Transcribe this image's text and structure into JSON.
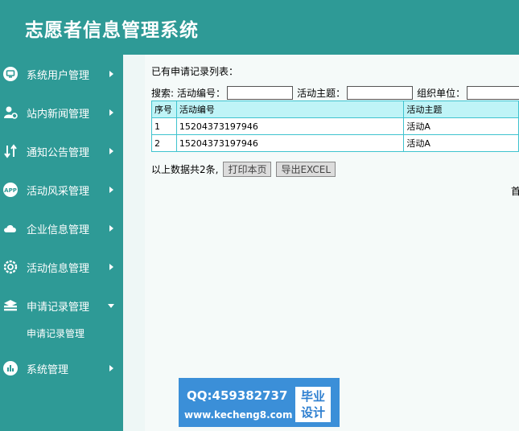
{
  "app": {
    "title": "志愿者信息管理系统"
  },
  "sidebar": {
    "items": [
      {
        "label": "系统用户管理",
        "icon": "monitor-icon"
      },
      {
        "label": "站内新闻管理",
        "icon": "user-settings-icon"
      },
      {
        "label": "通知公告管理",
        "icon": "transfer-icon"
      },
      {
        "label": "活动风采管理",
        "icon": "app-icon"
      },
      {
        "label": "企业信息管理",
        "icon": "cloud-icon"
      },
      {
        "label": "活动信息管理",
        "icon": "gear-icon"
      },
      {
        "label": "申请记录管理",
        "icon": "stack-icon",
        "expanded": true
      },
      {
        "label": "系统管理",
        "icon": "bar-chart-icon"
      }
    ],
    "sub_items": [
      {
        "label": "申请记录管理"
      }
    ]
  },
  "main": {
    "list_title": "已有申请记录列表：",
    "search": {
      "label": "搜索:",
      "field1_label": "活动编号：",
      "field2_label": "活动主题：",
      "field3_label": "组织单位：",
      "field1_value": "",
      "field2_value": "",
      "field3_value": ""
    },
    "table": {
      "headers": [
        "序号",
        "活动编号",
        "活动主题"
      ],
      "rows": [
        [
          "1",
          "15204373197946",
          "活动A"
        ],
        [
          "2",
          "15204373197946",
          "活动A"
        ]
      ]
    },
    "summary": "以上数据共2条,",
    "print_button": "打印本页",
    "export_button": "导出EXCEL",
    "pager_text": "首"
  },
  "banner": {
    "qq": "QQ:459382737",
    "site": "www.kecheng8.com",
    "badge_line1": "毕业",
    "badge_line2": "设计"
  },
  "colors": {
    "primary": "#2e9a96",
    "table_header": "#bff4f7",
    "table_border": "#3fc3cf",
    "banner": "#3b8fd8"
  }
}
